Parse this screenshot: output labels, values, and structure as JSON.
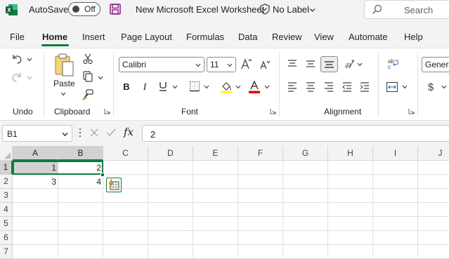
{
  "titlebar": {
    "autosave_label": "AutoSave",
    "autosave_state": "Off",
    "doc_title": "New Microsoft Excel Worksheet",
    "sensitivity_label": "No Label",
    "search_placeholder": "Search"
  },
  "tabs": [
    "File",
    "Home",
    "Insert",
    "Page Layout",
    "Formulas",
    "Data",
    "Review",
    "View",
    "Automate",
    "Help"
  ],
  "active_tab": "Home",
  "ribbon": {
    "groups": {
      "undo": "Undo",
      "clipboard": "Clipboard",
      "font": "Font",
      "alignment": "Alignment"
    },
    "paste_label": "Paste",
    "font_name": "Calibri",
    "font_size": "11",
    "number_format": "General",
    "font_color": "#e00000",
    "highlight_color": "#ffff00"
  },
  "formula_bar": {
    "name_box": "B1",
    "fx_label": "fx",
    "formula": "2"
  },
  "grid": {
    "columns": [
      "A",
      "B",
      "C",
      "D",
      "E",
      "F",
      "G",
      "H",
      "I",
      "J"
    ],
    "rows": [
      "1",
      "2",
      "3",
      "4",
      "5",
      "6",
      "7"
    ],
    "cells": {
      "A1": "1",
      "B1": "2",
      "A2": "3",
      "B2": "4"
    },
    "active_cell": "B1",
    "selected_range": "A1:B1"
  },
  "colors": {
    "accent": "#107c41",
    "selection_fill": "#d2d2d2"
  }
}
